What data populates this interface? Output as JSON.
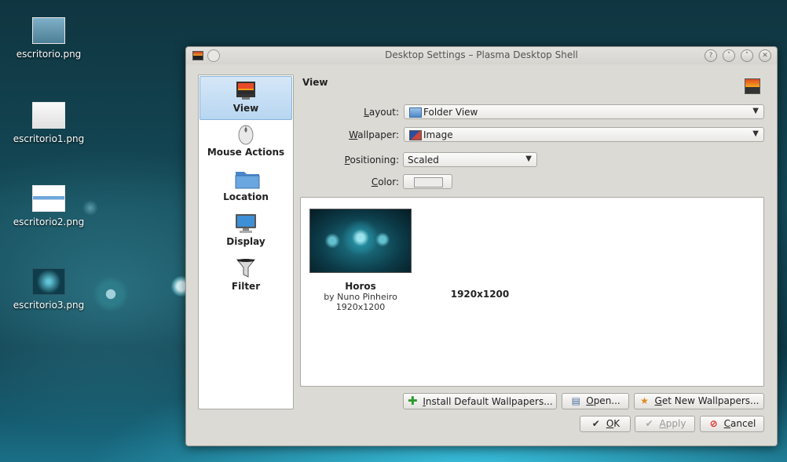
{
  "desktop": {
    "icons": [
      {
        "label": "escritorio.png",
        "thumb_color": "#5b8fa8"
      },
      {
        "label": "escritorio1.png",
        "thumb_color": "#f0f0f0"
      },
      {
        "label": "escritorio2.png",
        "thumb_color": "#f4f4f4"
      },
      {
        "label": "escritorio3.png",
        "thumb_color": "#0e3c4a"
      }
    ]
  },
  "window": {
    "title": "Desktop Settings – Plasma Desktop Shell",
    "buttons": {
      "help": "?",
      "minimize": "˅",
      "maximize": "˄",
      "close": "✕"
    }
  },
  "sidebar": {
    "items": [
      {
        "label": "View",
        "icon": "view-icon"
      },
      {
        "label": "Mouse Actions",
        "icon": "mouse-icon"
      },
      {
        "label": "Location",
        "icon": "folder-icon"
      },
      {
        "label": "Display",
        "icon": "monitor-icon"
      },
      {
        "label": "Filter",
        "icon": "funnel-icon"
      }
    ]
  },
  "view_page": {
    "title": "View",
    "layout": {
      "label_prefix": "L",
      "label_rest": "ayout:",
      "value": "Folder View"
    },
    "wallpaper": {
      "label_prefix": "W",
      "label_rest": "allpaper:",
      "value": "Image"
    },
    "positioning": {
      "label_prefix": "P",
      "label_rest": "ositioning:",
      "value": "Scaled"
    },
    "color": {
      "label_prefix": "C",
      "label_rest": "olor:",
      "swatch": "#ecebe9"
    }
  },
  "wallpapers": [
    {
      "name": "Horos",
      "author": "by Nuno Pinheiro",
      "resolution": "1920x1200"
    },
    {
      "name": "1920x1200"
    }
  ],
  "buttons": {
    "install": {
      "prefix": "I",
      "rest": "nstall Default Wallpapers..."
    },
    "open": {
      "prefix": "O",
      "rest": "pen..."
    },
    "get_new": {
      "prefix": "G",
      "rest": "et New Wallpapers..."
    },
    "ok": {
      "prefix": "O",
      "rest": "K"
    },
    "apply": {
      "prefix": "A",
      "rest": "pply"
    },
    "cancel": {
      "prefix": "C",
      "rest": "ancel"
    }
  },
  "colors": {
    "accent": "#b8d6f1",
    "dialog_bg": "#dcdad5"
  }
}
